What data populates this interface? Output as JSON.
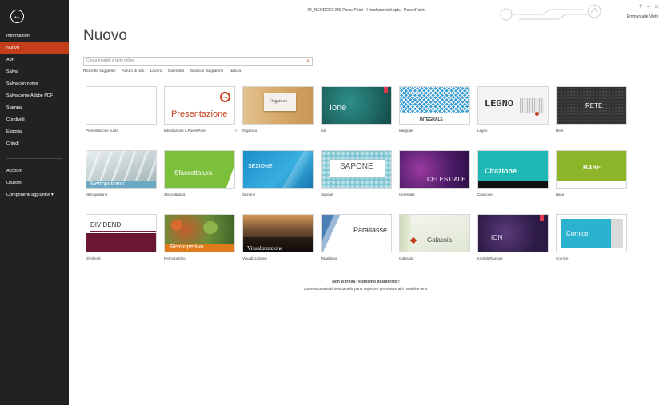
{
  "window": {
    "title": "04_NEODCEC MS-PowerPoint - I fondamentali.pptx - PowerPoint",
    "help": "?",
    "minimize": "–",
    "restore": "□",
    "user": "Emmanuele Vietti"
  },
  "sidebar": {
    "back_icon": "←",
    "items": [
      {
        "label": "Informazioni"
      },
      {
        "label": "Nuovo"
      },
      {
        "label": "Apri"
      },
      {
        "label": "Salva"
      },
      {
        "label": "Salva con nome"
      },
      {
        "label": "Salva come Adobe PDF"
      },
      {
        "label": "Stampa"
      },
      {
        "label": "Condividi"
      },
      {
        "label": "Esporta"
      },
      {
        "label": "Chiudi"
      },
      {
        "label": "Account"
      },
      {
        "label": "Opzioni"
      },
      {
        "label": "Componenti aggiuntivi ▾"
      }
    ]
  },
  "main": {
    "title": "Nuovo",
    "search_placeholder": "Cerca modelli e temi online",
    "search_icon": "⌕",
    "suggestions_label": "Ricerche suggerite:",
    "suggestions": [
      "Album di foto",
      "Lavoro",
      "Calendari",
      "Grafici e diagrammi",
      "Natura"
    ]
  },
  "templates": [
    {
      "label": "Presentazione vuota",
      "thumb_text": ""
    },
    {
      "label": "Introduzione a PowerPoint",
      "thumb_text": "Presentazione"
    },
    {
      "label": "Organico",
      "thumb_text": "Organico"
    },
    {
      "label": "Ioni",
      "thumb_text": "Ione"
    },
    {
      "label": "Integrale",
      "thumb_text": "INTEGRALE"
    },
    {
      "label": "Legno",
      "thumb_text": "LEGNO"
    },
    {
      "label": "Rete",
      "thumb_text": "RETE"
    },
    {
      "label": "Metropolitano",
      "thumb_text": "Metropolitano"
    },
    {
      "label": "Sfaccettatura",
      "thumb_text": "Sfaccettatura"
    },
    {
      "label": "Sezione",
      "thumb_text": "SEZIONE"
    },
    {
      "label": "Sapone",
      "thumb_text": "SAPONE"
    },
    {
      "label": "Celestiale",
      "thumb_text": "CELESTIALE"
    },
    {
      "label": "Citazione",
      "thumb_text": "Citazione"
    },
    {
      "label": "Base",
      "thumb_text": "BASE"
    },
    {
      "label": "Dividendi",
      "thumb_text": "DIVIDENDI"
    },
    {
      "label": "Retrospettivo",
      "thumb_text": "Retrospettivo"
    },
    {
      "label": "Visualizzazione",
      "thumb_text": "Visualizzazione"
    },
    {
      "label": "Parallasse",
      "thumb_text": "Parallasse"
    },
    {
      "label": "Galassia",
      "thumb_text": "Galassia"
    },
    {
      "label": "IonSalaRiunioni",
      "thumb_text": "ION"
    },
    {
      "label": "Cornice",
      "thumb_text": "Cornice"
    }
  ],
  "pin_icon": "⊣",
  "not_found": {
    "title": "Non si trova l'elemento desiderato?",
    "subtitle": "Usare la casella di ricerca nella parte superiore per trovare altri modelli e temi."
  },
  "colors": {
    "sidebar_bg": "#222222",
    "accent": "#c43e1c"
  }
}
